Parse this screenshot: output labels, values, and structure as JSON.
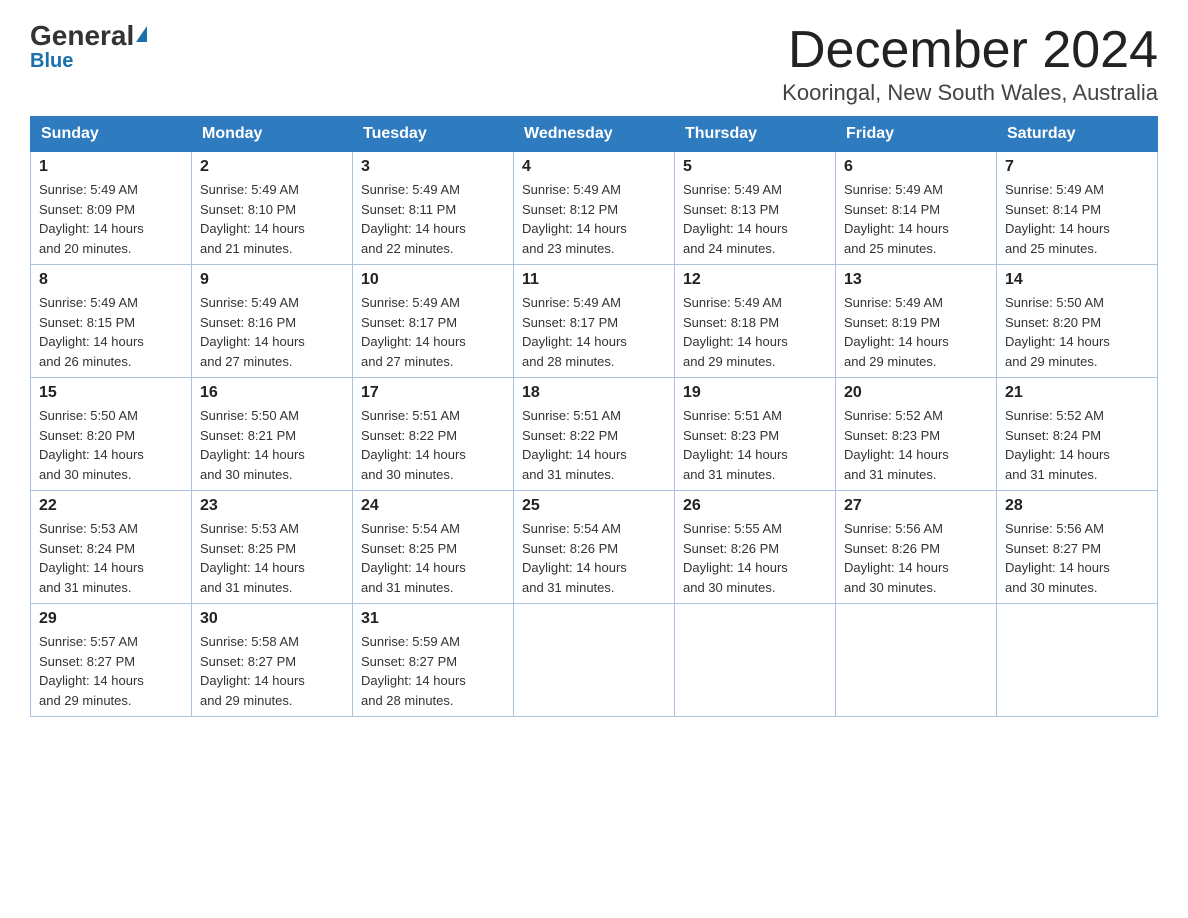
{
  "header": {
    "logo_general": "General",
    "logo_blue": "Blue",
    "title": "December 2024",
    "subtitle": "Kooringal, New South Wales, Australia"
  },
  "days_of_week": [
    "Sunday",
    "Monday",
    "Tuesday",
    "Wednesday",
    "Thursday",
    "Friday",
    "Saturday"
  ],
  "weeks": [
    [
      {
        "day": "1",
        "sunrise": "5:49 AM",
        "sunset": "8:09 PM",
        "daylight_hours": "14",
        "daylight_minutes": "20"
      },
      {
        "day": "2",
        "sunrise": "5:49 AM",
        "sunset": "8:10 PM",
        "daylight_hours": "14",
        "daylight_minutes": "21"
      },
      {
        "day": "3",
        "sunrise": "5:49 AM",
        "sunset": "8:11 PM",
        "daylight_hours": "14",
        "daylight_minutes": "22"
      },
      {
        "day": "4",
        "sunrise": "5:49 AM",
        "sunset": "8:12 PM",
        "daylight_hours": "14",
        "daylight_minutes": "23"
      },
      {
        "day": "5",
        "sunrise": "5:49 AM",
        "sunset": "8:13 PM",
        "daylight_hours": "14",
        "daylight_minutes": "24"
      },
      {
        "day": "6",
        "sunrise": "5:49 AM",
        "sunset": "8:14 PM",
        "daylight_hours": "14",
        "daylight_minutes": "25"
      },
      {
        "day": "7",
        "sunrise": "5:49 AM",
        "sunset": "8:14 PM",
        "daylight_hours": "14",
        "daylight_minutes": "25"
      }
    ],
    [
      {
        "day": "8",
        "sunrise": "5:49 AM",
        "sunset": "8:15 PM",
        "daylight_hours": "14",
        "daylight_minutes": "26"
      },
      {
        "day": "9",
        "sunrise": "5:49 AM",
        "sunset": "8:16 PM",
        "daylight_hours": "14",
        "daylight_minutes": "27"
      },
      {
        "day": "10",
        "sunrise": "5:49 AM",
        "sunset": "8:17 PM",
        "daylight_hours": "14",
        "daylight_minutes": "27"
      },
      {
        "day": "11",
        "sunrise": "5:49 AM",
        "sunset": "8:17 PM",
        "daylight_hours": "14",
        "daylight_minutes": "28"
      },
      {
        "day": "12",
        "sunrise": "5:49 AM",
        "sunset": "8:18 PM",
        "daylight_hours": "14",
        "daylight_minutes": "29"
      },
      {
        "day": "13",
        "sunrise": "5:49 AM",
        "sunset": "8:19 PM",
        "daylight_hours": "14",
        "daylight_minutes": "29"
      },
      {
        "day": "14",
        "sunrise": "5:50 AM",
        "sunset": "8:20 PM",
        "daylight_hours": "14",
        "daylight_minutes": "29"
      }
    ],
    [
      {
        "day": "15",
        "sunrise": "5:50 AM",
        "sunset": "8:20 PM",
        "daylight_hours": "14",
        "daylight_minutes": "30"
      },
      {
        "day": "16",
        "sunrise": "5:50 AM",
        "sunset": "8:21 PM",
        "daylight_hours": "14",
        "daylight_minutes": "30"
      },
      {
        "day": "17",
        "sunrise": "5:51 AM",
        "sunset": "8:22 PM",
        "daylight_hours": "14",
        "daylight_minutes": "30"
      },
      {
        "day": "18",
        "sunrise": "5:51 AM",
        "sunset": "8:22 PM",
        "daylight_hours": "14",
        "daylight_minutes": "31"
      },
      {
        "day": "19",
        "sunrise": "5:51 AM",
        "sunset": "8:23 PM",
        "daylight_hours": "14",
        "daylight_minutes": "31"
      },
      {
        "day": "20",
        "sunrise": "5:52 AM",
        "sunset": "8:23 PM",
        "daylight_hours": "14",
        "daylight_minutes": "31"
      },
      {
        "day": "21",
        "sunrise": "5:52 AM",
        "sunset": "8:24 PM",
        "daylight_hours": "14",
        "daylight_minutes": "31"
      }
    ],
    [
      {
        "day": "22",
        "sunrise": "5:53 AM",
        "sunset": "8:24 PM",
        "daylight_hours": "14",
        "daylight_minutes": "31"
      },
      {
        "day": "23",
        "sunrise": "5:53 AM",
        "sunset": "8:25 PM",
        "daylight_hours": "14",
        "daylight_minutes": "31"
      },
      {
        "day": "24",
        "sunrise": "5:54 AM",
        "sunset": "8:25 PM",
        "daylight_hours": "14",
        "daylight_minutes": "31"
      },
      {
        "day": "25",
        "sunrise": "5:54 AM",
        "sunset": "8:26 PM",
        "daylight_hours": "14",
        "daylight_minutes": "31"
      },
      {
        "day": "26",
        "sunrise": "5:55 AM",
        "sunset": "8:26 PM",
        "daylight_hours": "14",
        "daylight_minutes": "30"
      },
      {
        "day": "27",
        "sunrise": "5:56 AM",
        "sunset": "8:26 PM",
        "daylight_hours": "14",
        "daylight_minutes": "30"
      },
      {
        "day": "28",
        "sunrise": "5:56 AM",
        "sunset": "8:27 PM",
        "daylight_hours": "14",
        "daylight_minutes": "30"
      }
    ],
    [
      {
        "day": "29",
        "sunrise": "5:57 AM",
        "sunset": "8:27 PM",
        "daylight_hours": "14",
        "daylight_minutes": "29"
      },
      {
        "day": "30",
        "sunrise": "5:58 AM",
        "sunset": "8:27 PM",
        "daylight_hours": "14",
        "daylight_minutes": "29"
      },
      {
        "day": "31",
        "sunrise": "5:59 AM",
        "sunset": "8:27 PM",
        "daylight_hours": "14",
        "daylight_minutes": "28"
      },
      null,
      null,
      null,
      null
    ]
  ]
}
